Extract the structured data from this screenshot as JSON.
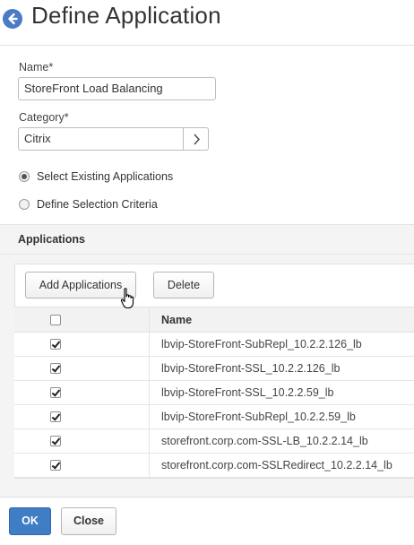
{
  "header": {
    "title": "Define Application",
    "back_icon": "arrow-left-circle-icon"
  },
  "form": {
    "name_label": "Name*",
    "name_value": "StoreFront Load Balancing",
    "category_label": "Category*",
    "category_value": "Citrix",
    "category_button_icon": "chevron-right-icon",
    "radios": [
      {
        "label": "Select Existing Applications",
        "checked": true
      },
      {
        "label": "Define Selection Criteria",
        "checked": false
      }
    ]
  },
  "applications": {
    "section_title": "Applications",
    "add_button": "Add Applications",
    "delete_button": "Delete",
    "columns": [
      "",
      "Name"
    ],
    "select_all_checked": false,
    "rows": [
      {
        "name": "lbvip-StoreFront-SubRepl_10.2.2.126_lb",
        "checked": true
      },
      {
        "name": "lbvip-StoreFront-SSL_10.2.2.126_lb",
        "checked": true
      },
      {
        "name": "lbvip-StoreFront-SSL_10.2.2.59_lb",
        "checked": true
      },
      {
        "name": "lbvip-StoreFront-SubRepl_10.2.2.59_lb",
        "checked": true
      },
      {
        "name": "storefront.corp.com-SSL-LB_10.2.2.14_lb",
        "checked": true
      },
      {
        "name": "storefront.corp.com-SSLRedirect_10.2.2.14_lb",
        "checked": true
      }
    ]
  },
  "footer": {
    "ok_label": "OK",
    "close_label": "Close"
  },
  "colors": {
    "accent": "#3f7dc4",
    "back_icon": "#4a7bc4"
  }
}
